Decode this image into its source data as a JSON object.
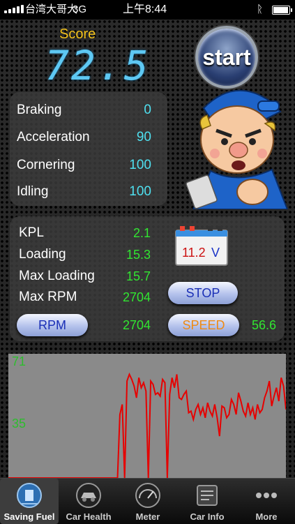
{
  "status_bar": {
    "carrier": "台湾大哥大",
    "network": "3G",
    "time": "上午8:44"
  },
  "score": {
    "label": "Score",
    "value": "72.5"
  },
  "start_label": "start",
  "driving_stats": [
    {
      "label": "Braking",
      "value": "0"
    },
    {
      "label": "Acceleration",
      "value": "90"
    },
    {
      "label": "Cornering",
      "value": "100"
    },
    {
      "label": "Idling",
      "value": "100"
    }
  ],
  "engine_stats": [
    {
      "label": "KPL",
      "value": "2.1"
    },
    {
      "label": "Loading",
      "value": "15.3"
    },
    {
      "label": "Max Loading",
      "value": "15.7"
    },
    {
      "label": "Max RPM",
      "value": "2704"
    }
  ],
  "battery": {
    "value": "11.2",
    "unit": "V"
  },
  "buttons": {
    "stop": "STOP",
    "rpm": "RPM",
    "rpm_value": "2704",
    "speed": "SPEED",
    "speed_value": "56.6"
  },
  "chart_data": {
    "type": "line",
    "y_ticks": [
      "71",
      "35"
    ],
    "ylim": [
      0,
      71
    ],
    "series": [
      {
        "color": "#e60000",
        "values": [
          0,
          0,
          0,
          0,
          0,
          0,
          0,
          0,
          0,
          0,
          0,
          0,
          0,
          0,
          0,
          0,
          0,
          0,
          0,
          0,
          0,
          0,
          0,
          0,
          0,
          0,
          0,
          0,
          0,
          0,
          0,
          0,
          0,
          0,
          0,
          0,
          0,
          0,
          0,
          0,
          0,
          0,
          0,
          0,
          0,
          0,
          0,
          38,
          44,
          0,
          58,
          62,
          59,
          55,
          48,
          60,
          54,
          57,
          52,
          0,
          58,
          56,
          50,
          51,
          49,
          59,
          57,
          0,
          50,
          60,
          54,
          62,
          48,
          47,
          50,
          52,
          39,
          40,
          35,
          41,
          44,
          38,
          42,
          36,
          45,
          40,
          37,
          44,
          36,
          25,
          43,
          42,
          36,
          38,
          47,
          44,
          38,
          51,
          46,
          40,
          37,
          45,
          38,
          42,
          35,
          44,
          39,
          41,
          48,
          52,
          58,
          43,
          49,
          54,
          46,
          60,
          55,
          41
        ]
      }
    ]
  },
  "tabs": [
    {
      "label": "Saving Fuel",
      "icon": "saving-fuel-icon",
      "active": true
    },
    {
      "label": "Car Health",
      "icon": "car-health-icon",
      "active": false
    },
    {
      "label": "Meter",
      "icon": "meter-icon",
      "active": false
    },
    {
      "label": "Car Info",
      "icon": "car-info-icon",
      "active": false
    },
    {
      "label": "More",
      "icon": "more-icon",
      "active": false
    }
  ]
}
